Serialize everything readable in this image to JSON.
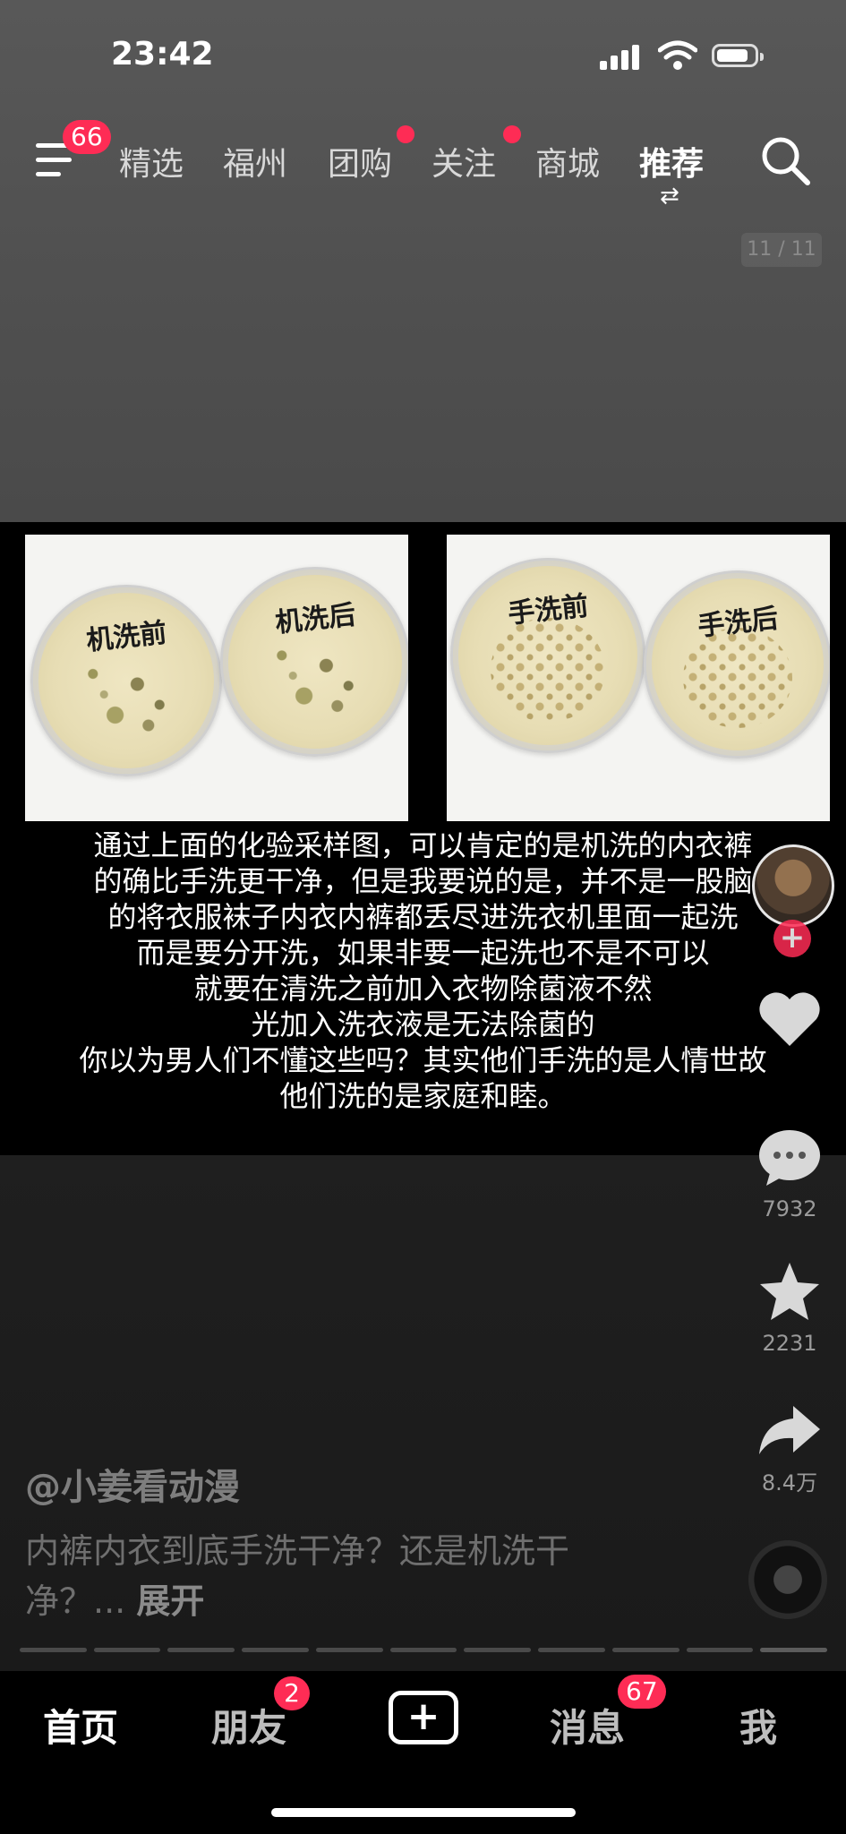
{
  "status_bar": {
    "time": "23:42"
  },
  "top_nav": {
    "menu_badge": "66",
    "tabs": [
      {
        "label": "精选",
        "dot": false,
        "active": false
      },
      {
        "label": "福州",
        "dot": false,
        "active": false
      },
      {
        "label": "团购",
        "dot": true,
        "active": false
      },
      {
        "label": "关注",
        "dot": true,
        "active": false
      },
      {
        "label": "商城",
        "dot": false,
        "active": false
      },
      {
        "label": "推荐",
        "dot": false,
        "active": true
      }
    ],
    "switch_glyph": "⇄"
  },
  "page_indicator": "11 / 11",
  "post": {
    "photos": [
      {
        "dish_labels": [
          "机洗前",
          "机洗后"
        ]
      },
      {
        "dish_labels": [
          "手洗前",
          "手洗后"
        ]
      }
    ],
    "caption_lines": [
      "通过上面的化验采样图，可以肯定的是机洗的内衣裤",
      "的确比手洗更干净，但是我要说的是，并不是一股脑",
      "的将衣服袜子内衣内裤都丢尽进洗衣机里面一起洗",
      "而是要分开洗，如果非要一起洗也不是不可以",
      "就要在清洗之前加入衣物除菌液不然",
      "光加入洗衣液是无法除菌的",
      "你以为男人们不懂这些吗？其实他们手洗的是人情世故",
      "他们洗的是家庭和睦。"
    ]
  },
  "side_actions": {
    "follow_plus": "+",
    "comments": "7932",
    "favorites": "2231",
    "shares": "8.4万"
  },
  "author": "@小姜看动漫",
  "description": "内裤内衣到底手洗干净？还是机洗干净？...",
  "expand_label": "展开",
  "progress": {
    "segments": 11,
    "current": 11
  },
  "bottom_nav": {
    "home": "首页",
    "friends": "朋友",
    "friends_badge": "2",
    "add": "+",
    "messages": "消息",
    "messages_badge": "67",
    "me": "我"
  },
  "colors": {
    "accent": "#fe2c55",
    "background": "#1b1b1b"
  }
}
